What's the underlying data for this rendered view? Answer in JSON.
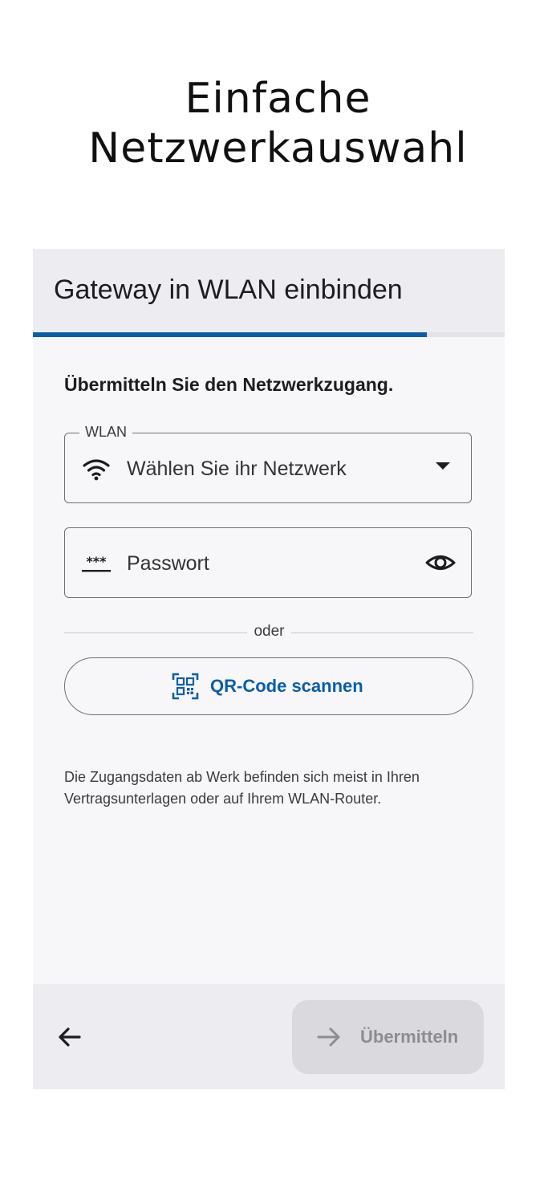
{
  "headline": {
    "line1": "Einfache",
    "line2": "Netzwerkauswahl"
  },
  "card": {
    "title": "Gateway in WLAN einbinden",
    "progress_fraction": 0.835,
    "instruction": "Übermitteln Sie den Netzwerkzugang.",
    "wlan_field": {
      "legend": "WLAN",
      "placeholder": "Wählen Sie ihr Netzwerk",
      "icon": "wifi-icon",
      "trailing_icon": "dropdown-arrow-icon"
    },
    "password_field": {
      "placeholder": "Passwort",
      "icon": "password-icon",
      "trailing_icon": "eye-icon"
    },
    "divider_label": "oder",
    "qr_button": {
      "label": "QR-Code scannen",
      "icon": "qr-code-icon"
    },
    "hint": "Die Zugangsdaten ab Werk befinden sich meist in Ihren Vertragsunterlagen oder auf Ihrem WLAN-Router."
  },
  "footer": {
    "back_icon": "arrow-left-icon",
    "submit_label": "Übermitteln",
    "submit_icon": "arrow-right-icon",
    "submit_enabled": false
  },
  "colors": {
    "accent": "#0a5ea8",
    "header_bg": "#ececf1",
    "card_bg": "#f7f7fa",
    "disabled_button": "#d9d9de"
  }
}
